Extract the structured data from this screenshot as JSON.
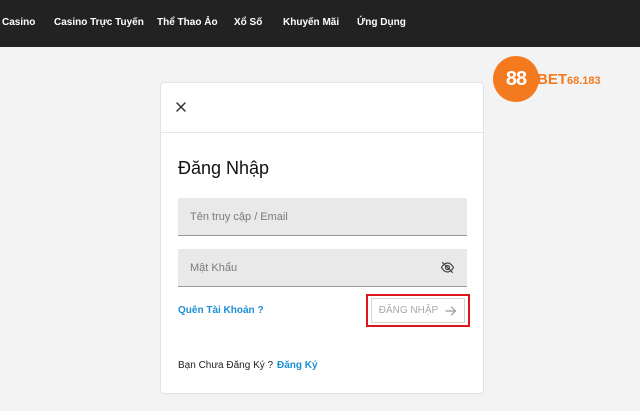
{
  "nav": {
    "items": [
      {
        "label": "Casino"
      },
      {
        "label": "Casino Trực Tuyến"
      },
      {
        "label": "Thể Thao Ảo"
      },
      {
        "label": "Xổ Số"
      },
      {
        "label": "Khuyến Mãi"
      },
      {
        "label": "Ứng Dụng"
      }
    ]
  },
  "logo": {
    "badge": "88",
    "brand": "BET",
    "suffix": "68.183"
  },
  "colors": {
    "accent": "#1a8fd6",
    "brand": "#f47a20",
    "highlight": "#e0141e",
    "nav_bg": "#222222"
  },
  "login": {
    "title": "Đăng Nhập",
    "username_placeholder": "Tên truy cập / Email",
    "password_placeholder": "Mật Khẩu",
    "forgot_label": "Quên Tài Khoản ?",
    "submit_label": "ĐĂNG NHẬP",
    "no_account_text": "Bạn Chưa Đăng Ký ?",
    "register_label": "Đăng Ký"
  }
}
